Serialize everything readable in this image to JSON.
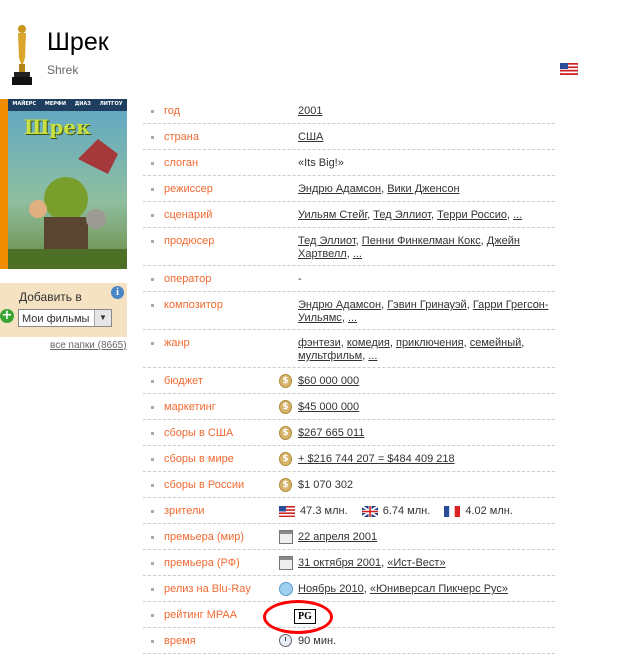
{
  "title": "Шрек",
  "original_title": "Shrek",
  "poster": {
    "banner_names": [
      "МАЙЕРС",
      "МЕРФИ",
      "ДИАЗ",
      "ЛИТГОУ"
    ],
    "title_text": "Шрек"
  },
  "add_to": {
    "label": "Добавить в",
    "selected": "Мои фильмы",
    "info": "i",
    "all_folders": "все папки (8665)"
  },
  "rows": [
    {
      "label": "год",
      "value": "2001",
      "link": true
    },
    {
      "label": "страна",
      "value": "США",
      "link": true
    },
    {
      "label": "слоган",
      "value": "«Its Big!»",
      "link": false
    },
    {
      "label": "режиссер",
      "links": [
        "Эндрю Адамсон",
        "Вики Дженсон"
      ]
    },
    {
      "label": "сценарий",
      "links": [
        "Уильям Стейг",
        "Тед Эллиот",
        "Терри Россио",
        "..."
      ]
    },
    {
      "label": "продюсер",
      "links": [
        "Тед Эллиот",
        "Пенни Финкелман Кокс",
        "Джейн Хартвелл",
        "..."
      ]
    },
    {
      "label": "оператор",
      "value": "-",
      "link": false
    },
    {
      "label": "композитор",
      "links": [
        "Эндрю Адамсон",
        "Гэвин Гринауэй",
        "Гарри Грегсон-Уильямс",
        "..."
      ]
    },
    {
      "label": "жанр",
      "links": [
        "фэнтези",
        "комедия",
        "приключения",
        "семейный",
        "мультфильм",
        "..."
      ]
    },
    {
      "label": "бюджет",
      "value": "$60 000 000",
      "link": true,
      "icon": "coin"
    },
    {
      "label": "маркетинг",
      "value": "$45 000 000",
      "link": true,
      "icon": "coin"
    },
    {
      "label": "сборы в США",
      "value": "$267 665 011",
      "link": true,
      "icon": "coin"
    },
    {
      "label": "сборы в мире",
      "value": "+ $216 744 207 = $484 409 218",
      "link": true,
      "icon": "coin"
    },
    {
      "label": "сборы в России",
      "value": "$1 070 302",
      "link": false,
      "icon": "coin"
    },
    {
      "label": "зрители",
      "viewers": [
        {
          "flag": "us",
          "value": "47.3 млн."
        },
        {
          "flag": "uk",
          "value": "6.74 млн."
        },
        {
          "flag": "fr",
          "value": "4.02 млн."
        }
      ]
    },
    {
      "label": "премьера (мир)",
      "value": "22 апреля 2001",
      "link": true,
      "icon": "calendar"
    },
    {
      "label": "премьера (РФ)",
      "links": [
        "31 октября 2001",
        "«Ист-Вест»"
      ],
      "icon": "calendar"
    },
    {
      "label": "релиз на Blu-Ray",
      "links": [
        "Ноябрь 2010",
        "«Юниверсал Пикчерс Рус»"
      ],
      "icon": "disc"
    },
    {
      "label": "рейтинг MPAA",
      "rating": "PG"
    },
    {
      "label": "время",
      "value": "90 мин.",
      "link": false,
      "icon": "clock"
    }
  ],
  "colors": {
    "label": "#f06a32",
    "accent_orange": "#f08c00",
    "annotation_red": "#ff0000"
  }
}
